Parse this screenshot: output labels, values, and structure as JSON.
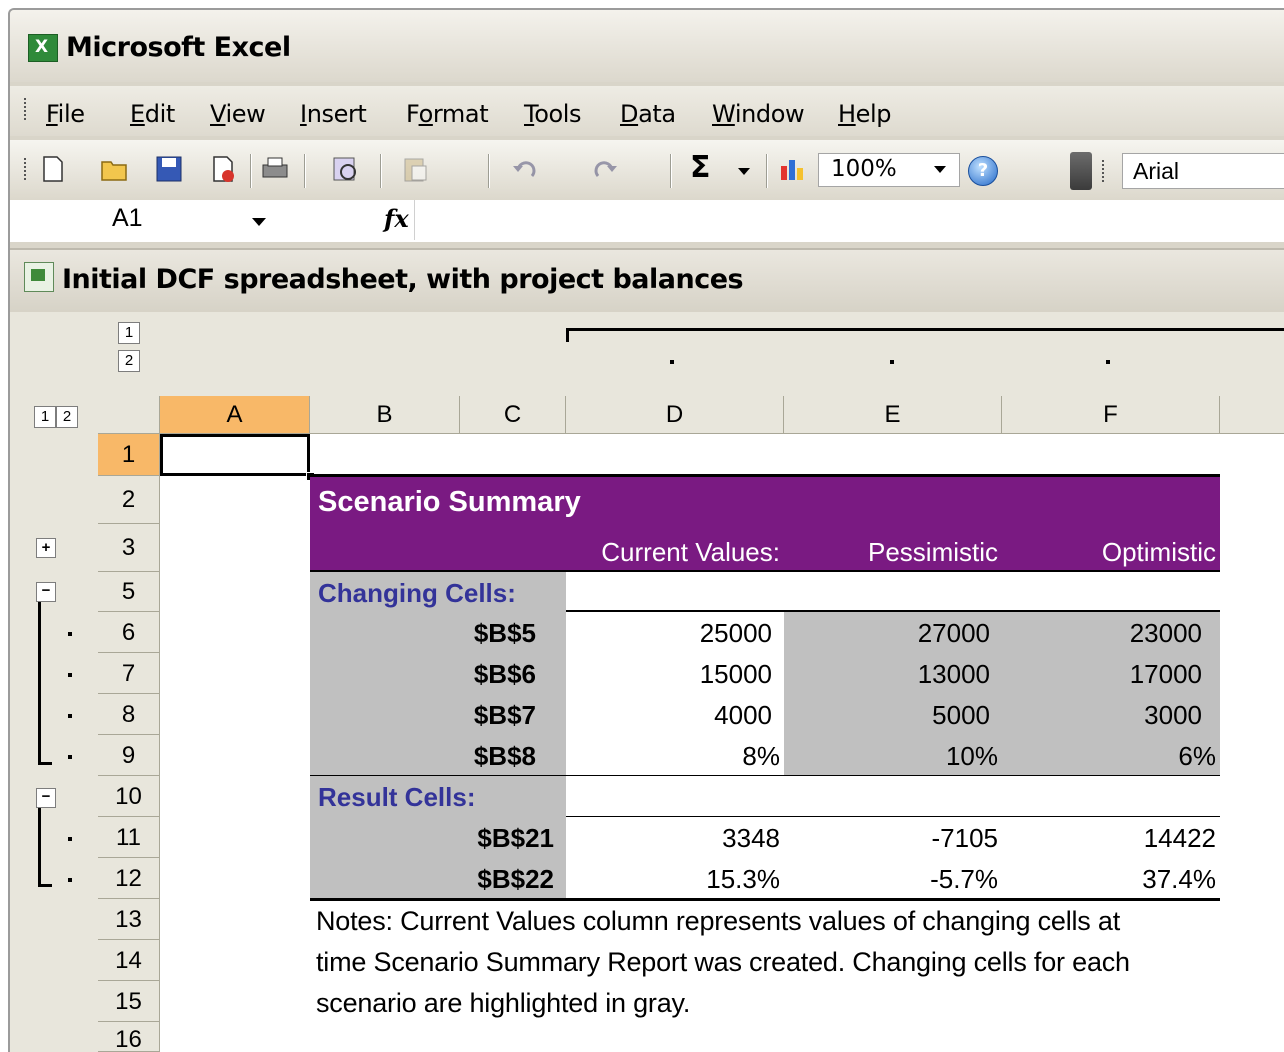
{
  "window": {
    "app_title": "Microsoft Excel"
  },
  "menu": [
    {
      "pre": "",
      "key": "F",
      "post": "ile"
    },
    {
      "pre": "",
      "key": "E",
      "post": "dit"
    },
    {
      "pre": "",
      "key": "V",
      "post": "iew"
    },
    {
      "pre": "",
      "key": "I",
      "post": "nsert"
    },
    {
      "pre": "F",
      "key": "o",
      "post": "rmat"
    },
    {
      "pre": "",
      "key": "T",
      "post": "ools"
    },
    {
      "pre": "",
      "key": "D",
      "post": "ata"
    },
    {
      "pre": "",
      "key": "W",
      "post": "indow"
    },
    {
      "pre": "",
      "key": "H",
      "post": "elp"
    }
  ],
  "toolbar": {
    "icons": [
      "new-icon",
      "open-icon",
      "save-icon",
      "permission-icon",
      "print-icon",
      "research-icon",
      "paste-icon",
      "undo-icon",
      "redo-icon",
      "autosum-icon",
      "chart-wizard-icon"
    ],
    "zoom": "100%",
    "font": "Arial",
    "sigma": "Σ"
  },
  "formula_bar": {
    "cell_ref": "A1",
    "fx": "fx",
    "formula": ""
  },
  "workbook": {
    "title": "Initial DCF spreadsheet, with project balances"
  },
  "outline": {
    "column_levels": [
      "1",
      "2"
    ],
    "row_levels": [
      "1",
      "2"
    ],
    "expand": "+",
    "collapse": "−"
  },
  "columns": [
    "A",
    "B",
    "C",
    "D",
    "E",
    "F"
  ],
  "rows": [
    "1",
    "2",
    "3",
    "5",
    "6",
    "7",
    "8",
    "9",
    "10",
    "11",
    "12",
    "13",
    "14",
    "15",
    "16"
  ],
  "scenario": {
    "title": "Scenario Summary",
    "headers": [
      "Current Values:",
      "Pessimistic",
      "Optimistic"
    ],
    "changing_label": "Changing Cells:",
    "changing": [
      {
        "cell": "$B$5",
        "values": [
          "25000",
          "27000",
          "23000"
        ]
      },
      {
        "cell": "$B$6",
        "values": [
          "15000",
          "13000",
          "17000"
        ]
      },
      {
        "cell": "$B$7",
        "values": [
          "4000",
          "5000",
          "3000"
        ]
      },
      {
        "cell": "$B$8",
        "values": [
          "8%",
          "10%",
          "6%"
        ]
      }
    ],
    "result_label": "Result Cells:",
    "results": [
      {
        "cell": "$B$21",
        "values": [
          "3348",
          "-7105",
          "14422"
        ]
      },
      {
        "cell": "$B$22",
        "values": [
          "15.3%",
          "-5.7%",
          "37.4%"
        ]
      }
    ],
    "notes": [
      "Notes:  Current Values column represents values of changing cells at",
      "time Scenario Summary Report was created.  Changing cells for each",
      "scenario are highlighted in gray."
    ]
  },
  "colors": {
    "header_purple": "#7a1a82",
    "changing_gray": "#c0c0c0",
    "label_navy": "#333399",
    "selected_header": "#f8b868"
  }
}
